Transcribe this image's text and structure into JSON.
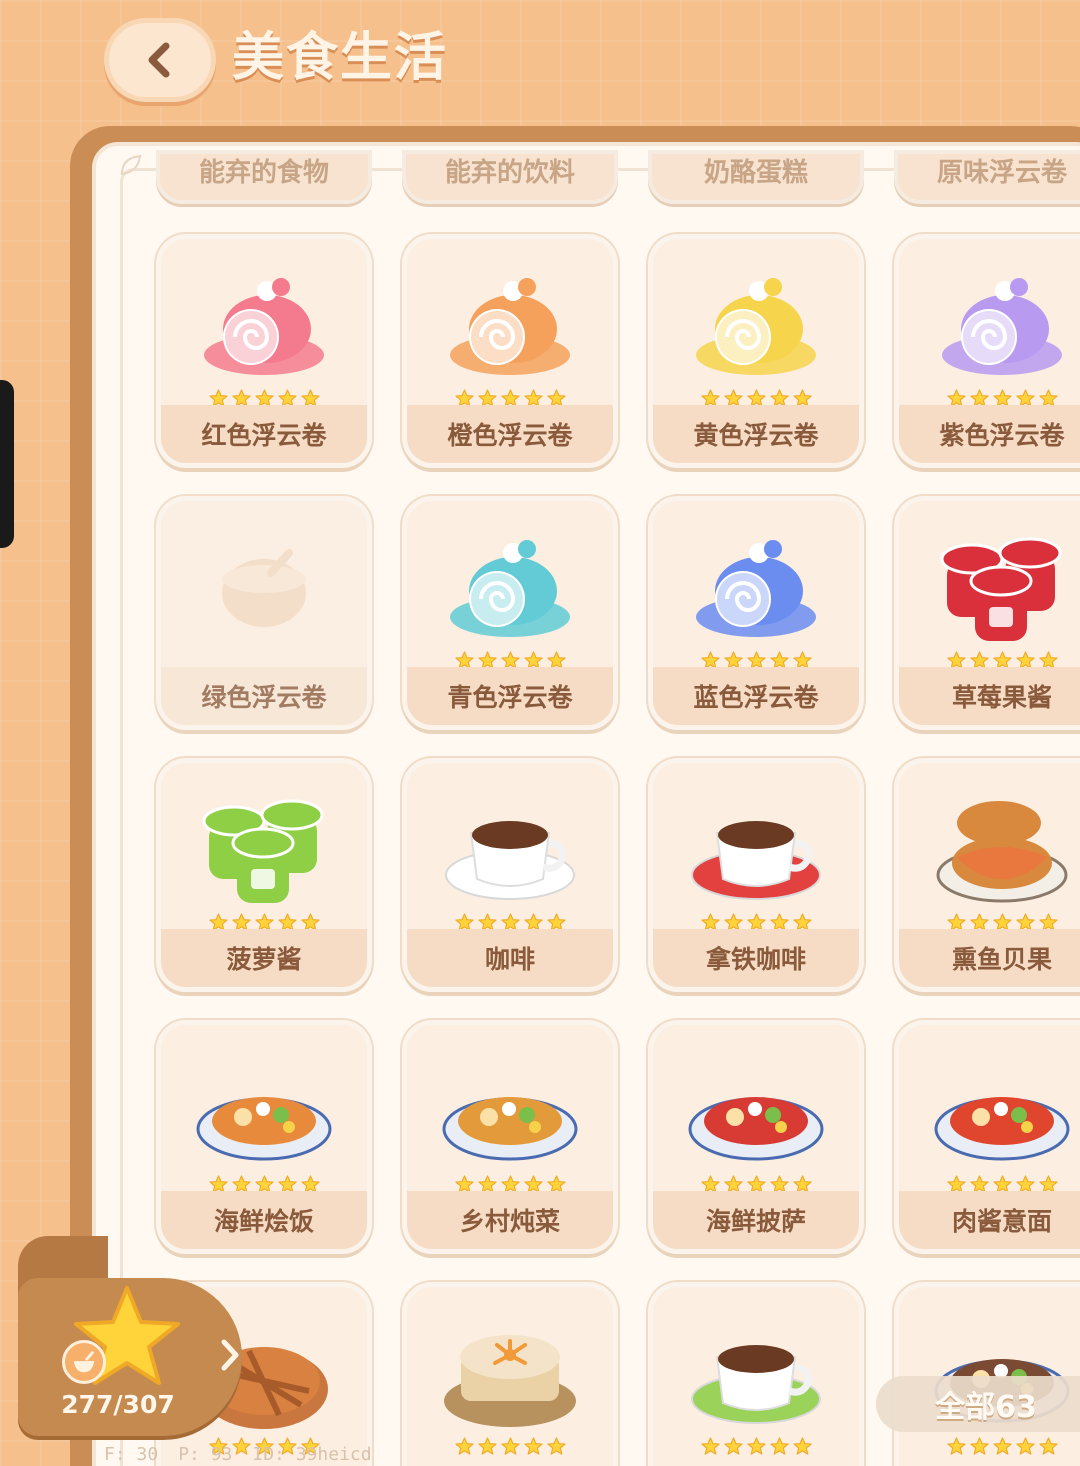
{
  "header": {
    "title": "美食生活"
  },
  "previous_row": [
    "能弃的食物",
    "能弃的饮料",
    "奶酪蛋糕",
    "原味浮云卷"
  ],
  "items": [
    {
      "name": "红色浮云卷",
      "locked": false,
      "stars": 5,
      "color": "#f47b8e",
      "kind": "roll"
    },
    {
      "name": "橙色浮云卷",
      "locked": false,
      "stars": 5,
      "color": "#f5a15c",
      "kind": "roll"
    },
    {
      "name": "黄色浮云卷",
      "locked": false,
      "stars": 5,
      "color": "#f6d44c",
      "kind": "roll"
    },
    {
      "name": "紫色浮云卷",
      "locked": false,
      "stars": 5,
      "color": "#b89af0",
      "kind": "roll"
    },
    {
      "name": "绿色浮云卷",
      "locked": true,
      "stars": 0,
      "color": "#f2d9c2",
      "kind": "bowl"
    },
    {
      "name": "青色浮云卷",
      "locked": false,
      "stars": 5,
      "color": "#62cbd6",
      "kind": "roll"
    },
    {
      "name": "蓝色浮云卷",
      "locked": false,
      "stars": 5,
      "color": "#6b8df0",
      "kind": "roll"
    },
    {
      "name": "草莓果酱",
      "locked": false,
      "stars": 5,
      "color": "#d9303c",
      "kind": "jar"
    },
    {
      "name": "菠萝酱",
      "locked": false,
      "stars": 5,
      "color": "#8fcf45",
      "kind": "jar"
    },
    {
      "name": "咖啡",
      "locked": false,
      "stars": 5,
      "color": "#ffffff",
      "kind": "cup"
    },
    {
      "name": "拿铁咖啡",
      "locked": false,
      "stars": 5,
      "color": "#e34040",
      "kind": "cup"
    },
    {
      "name": "熏鱼贝果",
      "locked": false,
      "stars": 5,
      "color": "#e8783e",
      "kind": "bagel"
    },
    {
      "name": "海鲜烩饭",
      "locked": false,
      "stars": 5,
      "color": "#e88a3c",
      "kind": "plate"
    },
    {
      "name": "乡村炖菜",
      "locked": false,
      "stars": 5,
      "color": "#e39a3a",
      "kind": "plate"
    },
    {
      "name": "海鲜披萨",
      "locked": false,
      "stars": 5,
      "color": "#d83b34",
      "kind": "plate"
    },
    {
      "name": "肉酱意面",
      "locked": false,
      "stars": 5,
      "color": "#e0452e",
      "kind": "plate"
    },
    {
      "name": "",
      "locked": false,
      "stars": 5,
      "color": "#d98140",
      "kind": "pie"
    },
    {
      "name": "",
      "locked": false,
      "stars": 5,
      "color": "#f4e3c8",
      "kind": "cake"
    },
    {
      "name": "",
      "locked": false,
      "stars": 5,
      "color": "#9bd35a",
      "kind": "cup"
    },
    {
      "name": "",
      "locked": false,
      "stars": 5,
      "color": "#7a4a32",
      "kind": "plate"
    }
  ],
  "progress": {
    "count": "277/307",
    "value": 277,
    "total": 307
  },
  "all_count": "全部63",
  "debug": {
    "f": "F: 30",
    "p": "P: 93",
    "id": "ID: 39heicd"
  },
  "colors": {
    "background": "#f6c08c",
    "star": "#ffd43a",
    "label_text": "#8a5a3c"
  }
}
